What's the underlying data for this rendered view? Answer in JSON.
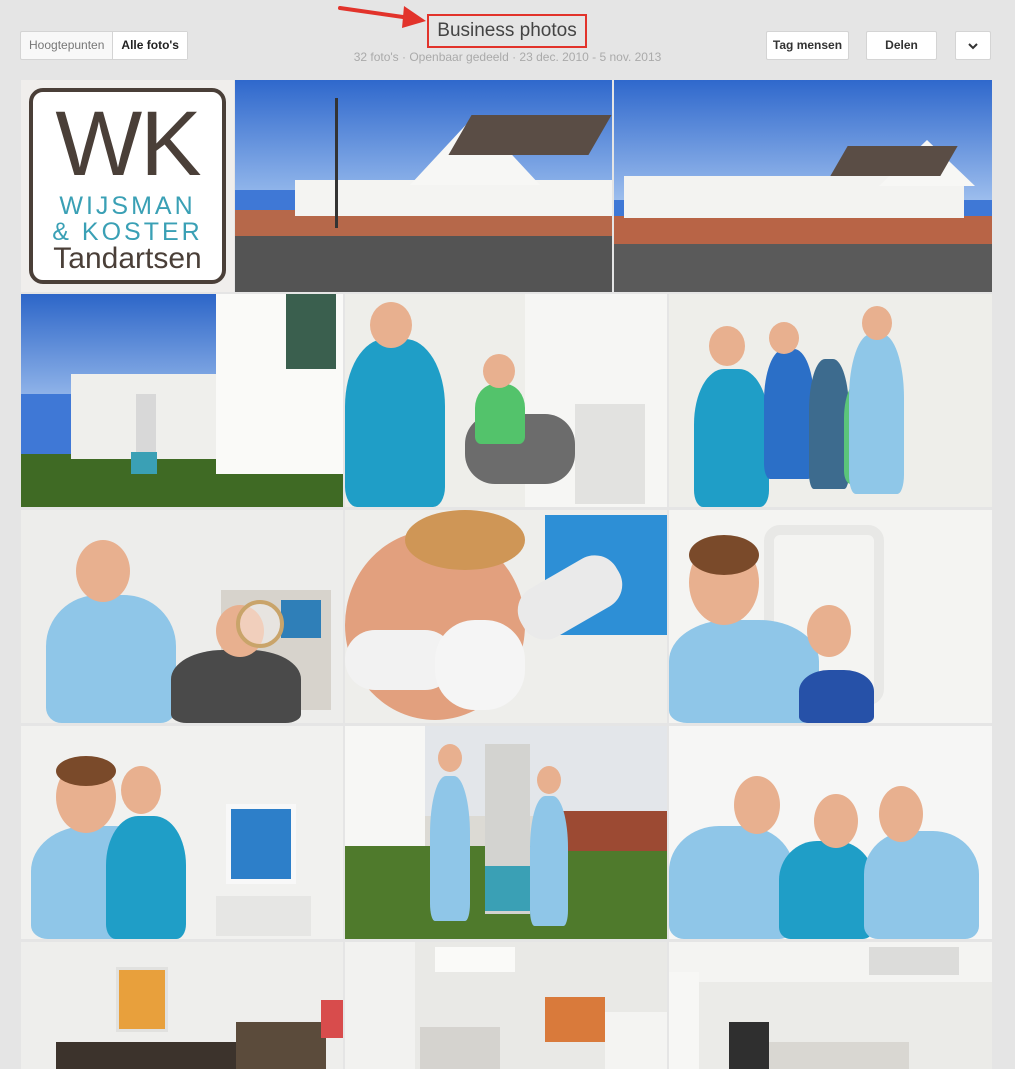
{
  "header": {
    "view_options": [
      "Hoogtepunten",
      "Alle foto's"
    ],
    "title": "Business photos",
    "meta": "32 foto's · Openbaar gedeeld · 23 dec. 2010 - 5 nov. 2013",
    "tag_button": "Tag mensen",
    "share_button": "Delen",
    "more_icon": "chevron-down-icon"
  },
  "logo": {
    "initials": "WK",
    "line1": "WIJSMAN",
    "line2": "& KOSTER",
    "line3": "Tandartsen"
  },
  "photos": [
    "logo",
    "building-front",
    "building-side",
    "building-entrance",
    "dentist-with-child",
    "team-with-children",
    "dentist-mirror-boy",
    "patient-scan",
    "dentist-xray",
    "dentists-screen",
    "dentists-sign",
    "team-portrait",
    "waiting-room",
    "treatment-room",
    "hallway-reception"
  ],
  "colors": {
    "accent_red": "#e2332b",
    "logo_teal": "#3aa0b5",
    "logo_brown": "#4a3f38"
  }
}
